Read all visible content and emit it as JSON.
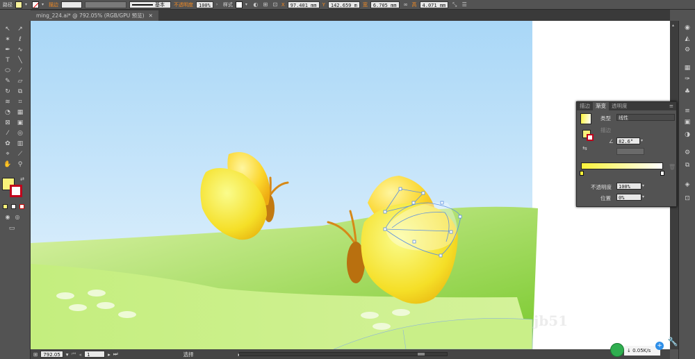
{
  "control_bar": {
    "path_label": "路径",
    "stroke_label": "描边",
    "stroke_style": "基本",
    "opacity_label": "不透明度",
    "opacity_value": "100%",
    "style_label": "样式",
    "x_label": "X",
    "x_value": "97.401 mm",
    "y_label": "Y",
    "y_value": "142.659 m",
    "w_label": "宽",
    "w_value": "6.705 mm",
    "h_label": "高",
    "h_value": "4.071 mm",
    "fill_color": "#f7f29a",
    "stroke_color": "#ffffff"
  },
  "document": {
    "tab_title": "ming_224.ai* @ 792.05% (RGB/GPU 预览)",
    "close_symbol": "✕"
  },
  "toolbar": {
    "fill_color": "#f8f27a",
    "stroke_color": "#ffffff"
  },
  "gradient_panel": {
    "tabs": [
      "描边",
      "渐变",
      "透明度"
    ],
    "active_tab": "渐变",
    "type_label": "类型",
    "type_value": "线性",
    "stroke_label": "描边",
    "angle_value": "82.6°",
    "opacity_label": "不透明度",
    "opacity_value": "100%",
    "position_label": "位置",
    "position_value": "0%",
    "gradient_start": "#fbf33a",
    "gradient_end": "#ffffff"
  },
  "status_bar": {
    "zoom_value": "792.05",
    "page_value": "1",
    "tool_name": "选择"
  },
  "tray": {
    "net_speed": "0.05K/s"
  },
  "watermark": "jb51"
}
